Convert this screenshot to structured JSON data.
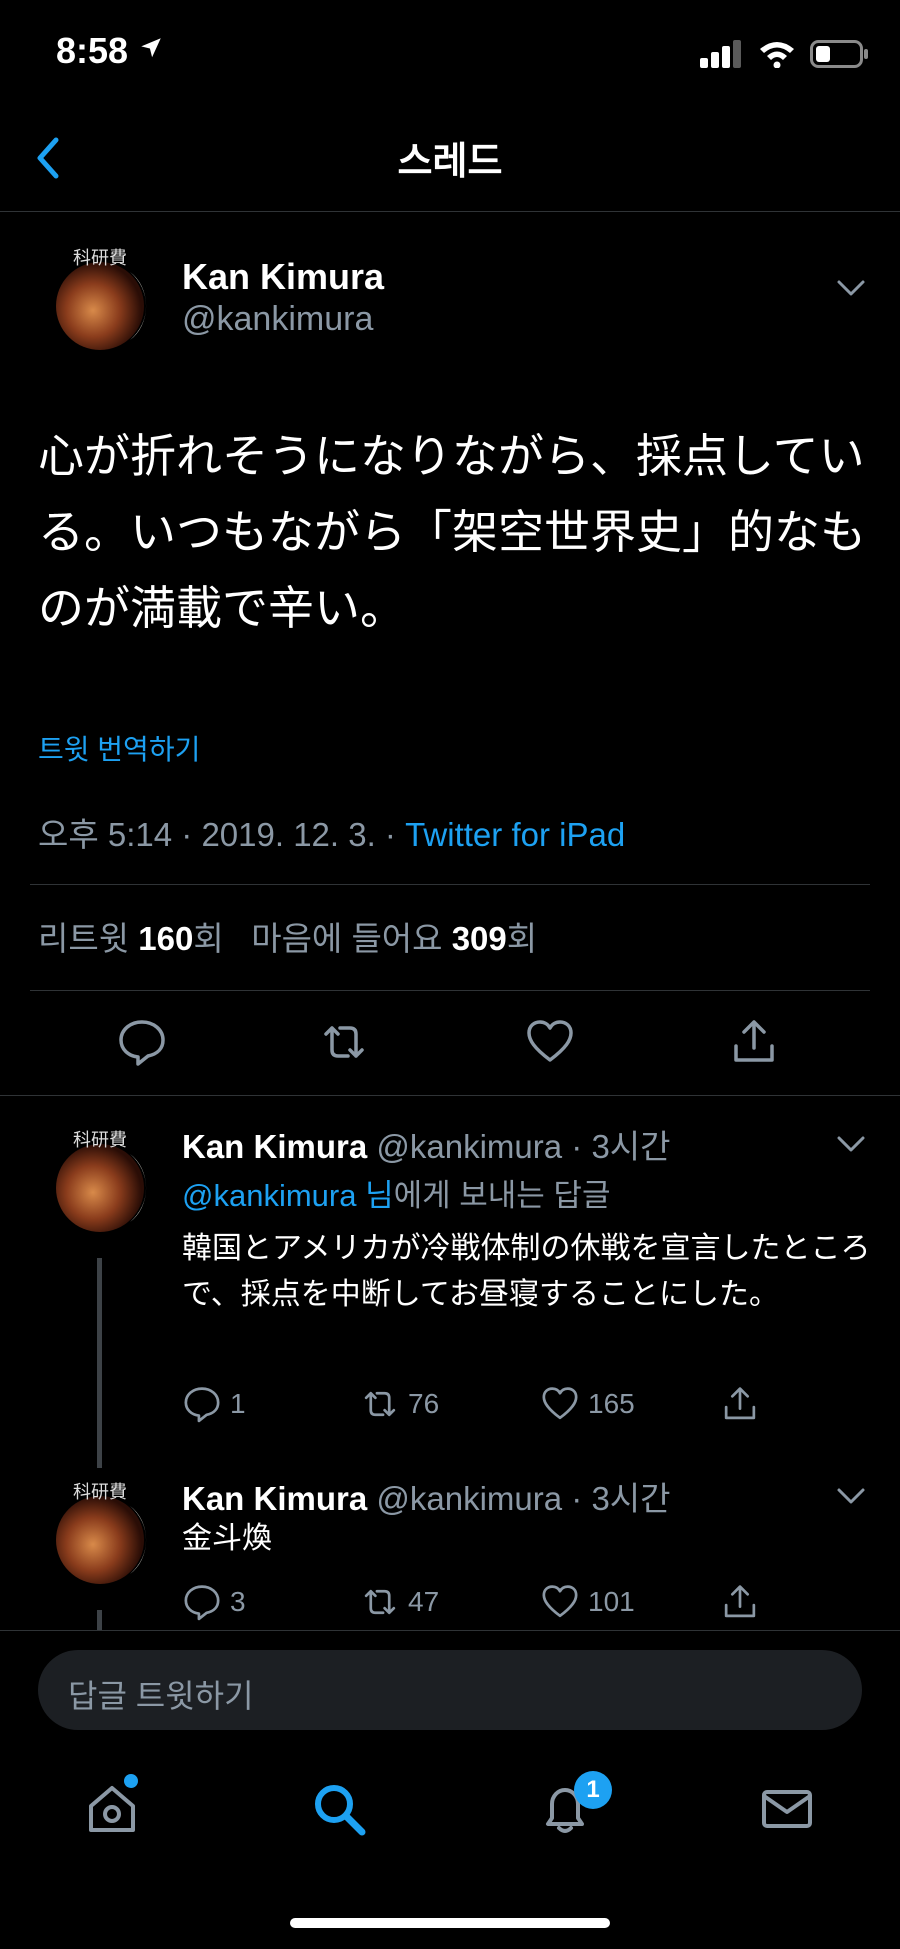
{
  "status": {
    "time": "8:58"
  },
  "header": {
    "title": "스레드"
  },
  "main_tweet": {
    "name": "Kan Kimura",
    "handle": "@kankimura",
    "text": "心が折れそうになりながら、採点している。いつもながら「架空世界史」的なものが満載で辛い。",
    "translate": "트윗 번역하기",
    "time_date": "오후 5:14 · 2019. 12. 3. · ",
    "source": "Twitter for iPad",
    "stats": {
      "retweet_label": "리트윗 ",
      "retweet_count": "160",
      "retweet_unit": "회",
      "like_label": "마음에 들어요 ",
      "like_count": "309",
      "like_unit": "회"
    }
  },
  "avatar_text": "科研費",
  "replies": [
    {
      "name": "Kan Kimura",
      "handle": "@kankimura · 3시간",
      "to_mention": "@kankimura 님",
      "to_rest": "에게 보내는 답글",
      "text": "韓国とアメリカが冷戦体制の休戦を宣言したところで、採点を中断してお昼寝することにした。",
      "replies": "1",
      "retweets": "76",
      "likes": "165"
    },
    {
      "name": "Kan Kimura",
      "handle": "@kankimura · 3시간",
      "text": "金斗煥",
      "replies": "3",
      "retweets": "47",
      "likes": "101"
    }
  ],
  "reply_box": {
    "placeholder": "답글 트윗하기"
  },
  "tabbar": {
    "notification_badge": "1"
  },
  "colors": {
    "accent": "#1da1f2",
    "background": "#000000",
    "muted": "#8b98a5"
  }
}
